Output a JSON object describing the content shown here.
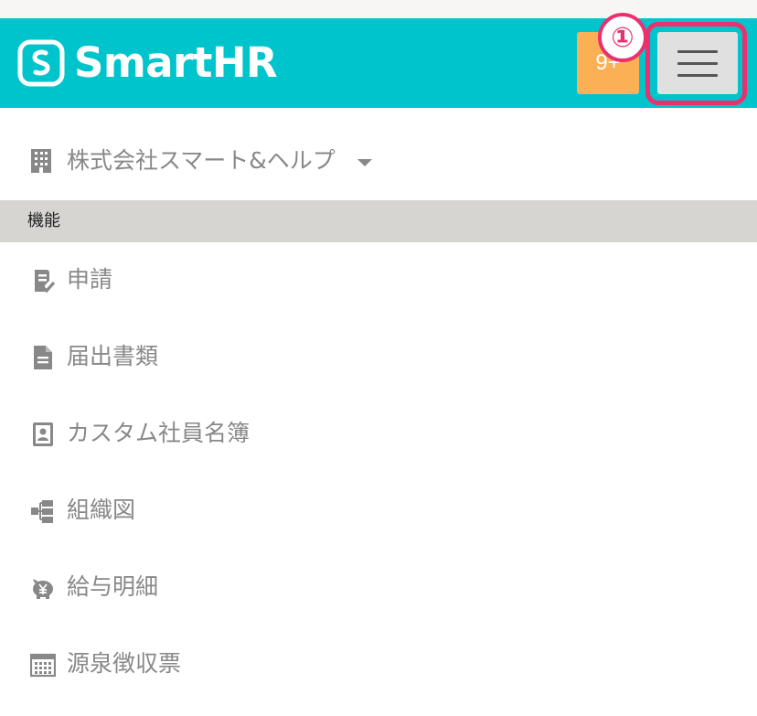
{
  "header": {
    "logo_text": "SmartHR",
    "notification_count": "9+",
    "step_marker": "①",
    "colors": {
      "bar": "#00c4cc",
      "badge": "#fbb056",
      "highlight": "#ec2f6e"
    }
  },
  "company": {
    "name": "株式会社スマート&ヘルプ"
  },
  "section": {
    "title": "機能"
  },
  "nav": {
    "items": [
      {
        "label": "申請",
        "icon": "request-check-icon"
      },
      {
        "label": "届出書類",
        "icon": "document-icon"
      },
      {
        "label": "カスタム社員名簿",
        "icon": "employee-directory-icon"
      },
      {
        "label": "組織図",
        "icon": "org-chart-icon"
      },
      {
        "label": "給与明細",
        "icon": "piggy-bank-icon"
      },
      {
        "label": "源泉徴収票",
        "icon": "calendar-icon"
      }
    ]
  }
}
